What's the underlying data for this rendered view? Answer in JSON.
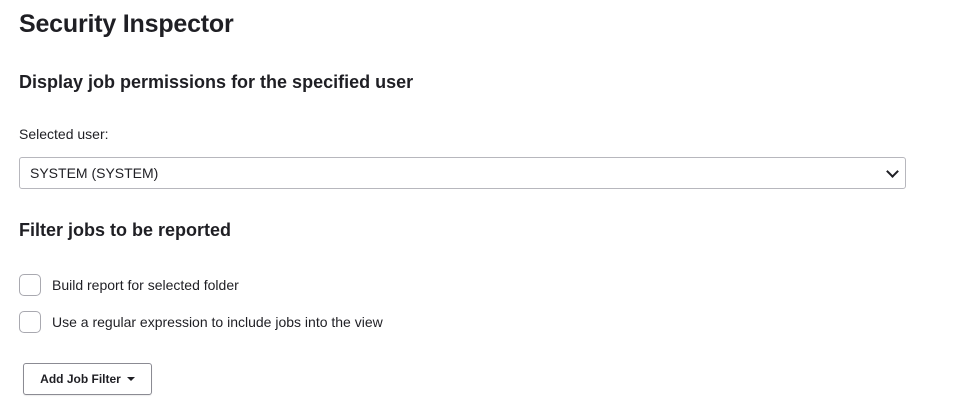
{
  "page": {
    "title": "Security Inspector"
  },
  "permissions": {
    "heading": "Display job permissions for the specified user",
    "user_label": "Selected user:",
    "selected_user": "SYSTEM (SYSTEM)"
  },
  "filters": {
    "heading": "Filter jobs to be reported",
    "options": [
      {
        "label": "Build report for selected folder",
        "checked": false
      },
      {
        "label": "Use a regular expression to include jobs into the view",
        "checked": false
      }
    ],
    "add_filter_label": "Add Job Filter"
  },
  "icons": {
    "select": "chevron-down-icon",
    "button": "caret-down-icon"
  }
}
